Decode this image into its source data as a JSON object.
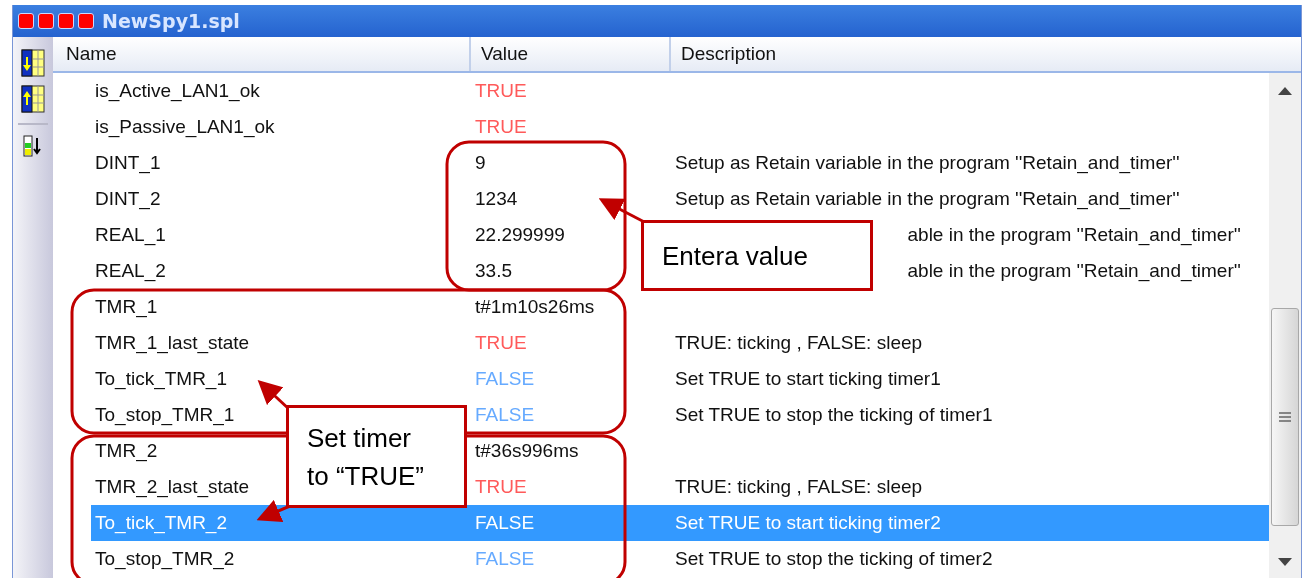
{
  "window": {
    "title": "NewSpy1.spl"
  },
  "columns": [
    "Name",
    "Value",
    "Description"
  ],
  "rows": [
    {
      "name": "is_Active_LAN1_ok",
      "value": "TRUE",
      "kind": "true",
      "selected": false
    },
    {
      "name": "is_Passive_LAN1_ok",
      "value": "TRUE",
      "kind": "true",
      "selected": false
    },
    {
      "name": "DINT_1",
      "value": "9",
      "kind": "text",
      "description": "Setup as Retain variable in the program ''Retain_and_timer''",
      "partial": false,
      "selected": false
    },
    {
      "name": "DINT_2",
      "value": "1234",
      "kind": "text",
      "description": "Setup as Retain variable in the program ''Retain_and_timer''",
      "partial": false,
      "selected": false
    },
    {
      "name": "REAL_1",
      "value": "22.299999",
      "kind": "text",
      "description": "able in the program ''Retain_and_timer''",
      "partial": true,
      "selected": false
    },
    {
      "name": "REAL_2",
      "value": "33.5",
      "kind": "text",
      "description": "able in the program ''Retain_and_timer''",
      "partial": true,
      "selected": false
    },
    {
      "name": "TMR_1",
      "value": "t#1m10s26ms",
      "kind": "text",
      "selected": false
    },
    {
      "name": "TMR_1_last_state",
      "value": "TRUE",
      "kind": "true",
      "description": "TRUE: ticking , FALSE: sleep",
      "partial": false,
      "selected": false
    },
    {
      "name": "To_tick_TMR_1",
      "value": "FALSE",
      "kind": "false",
      "description": "Set TRUE to start ticking timer1",
      "partial": false,
      "selected": false
    },
    {
      "name": "To_stop_TMR_1",
      "value": "FALSE",
      "kind": "false",
      "description": "Set TRUE to stop the ticking of timer1",
      "partial": false,
      "selected": false
    },
    {
      "name": "TMR_2",
      "value": "t#36s996ms",
      "kind": "text",
      "selected": false
    },
    {
      "name": "TMR_2_last_state",
      "value": "TRUE",
      "kind": "true",
      "description": "TRUE: ticking , FALSE: sleep",
      "partial": false,
      "selected": false
    },
    {
      "name": "To_tick_TMR_2",
      "value": "FALSE",
      "kind": "false",
      "description": "Set TRUE to start ticking timer2",
      "partial": false,
      "selected": true
    },
    {
      "name": "To_stop_TMR_2",
      "value": "FALSE",
      "kind": "false",
      "description": "Set TRUE to stop the ticking of timer2",
      "partial": false,
      "selected": false
    }
  ],
  "callouts": [
    {
      "text": "Entera value"
    },
    {
      "text": "Set timer to “TRUE”"
    }
  ]
}
